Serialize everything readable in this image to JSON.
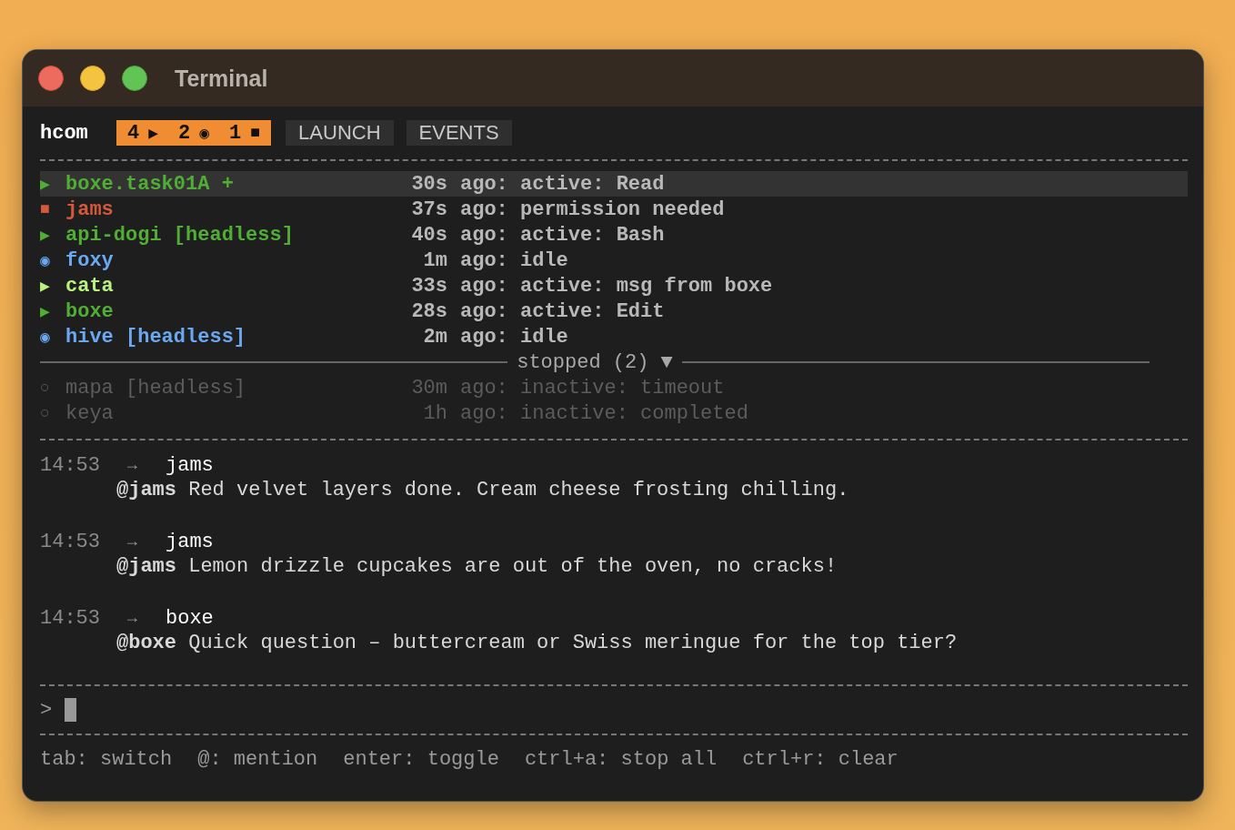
{
  "window": {
    "title": "Terminal"
  },
  "header": {
    "app": "hcom",
    "counts": [
      {
        "count": "4",
        "symbol": "▶"
      },
      {
        "count": "2",
        "symbol": "◉"
      },
      {
        "count": "1",
        "symbol": "■"
      }
    ],
    "tabs": [
      {
        "label": "LAUNCH",
        "selected": false
      },
      {
        "label": "EVENTS",
        "selected": false
      }
    ]
  },
  "agents": [
    {
      "symbol": "▶",
      "name": "boxe.task01A +",
      "time": "30s",
      "status": "ago: active: Read",
      "color": "#4fae33",
      "selected": true
    },
    {
      "symbol": "■",
      "name": "jams",
      "time": "37s",
      "status": "ago: permission needed",
      "color": "#d4583b",
      "selected": false
    },
    {
      "symbol": "▶",
      "name": "api-dogi [headless]",
      "time": "40s",
      "status": "ago: active: Bash",
      "color": "#4fae33",
      "selected": false
    },
    {
      "symbol": "◉",
      "name": "foxy",
      "time": "1m",
      "status": "ago: idle",
      "color": "#6aa9f2",
      "selected": false
    },
    {
      "symbol": "▶",
      "name": "cata",
      "time": "33s",
      "status": "ago: active: msg from boxe",
      "color": "#b8f27c",
      "selected": false
    },
    {
      "symbol": "▶",
      "name": "boxe",
      "time": "28s",
      "status": "ago: active: Edit",
      "color": "#4fae33",
      "selected": false
    },
    {
      "symbol": "◉",
      "name": "hive [headless]",
      "time": "2m",
      "status": "ago: idle",
      "color": "#6aa9f2",
      "selected": false
    }
  ],
  "stopped_group": {
    "label": "stopped (2)",
    "toggle": "▼",
    "expanded": true,
    "agents": [
      {
        "symbol": "○",
        "name": "mapa [headless]",
        "time": "30m",
        "status": "ago: inactive: timeout"
      },
      {
        "symbol": "○",
        "name": "keya",
        "time": "1h",
        "status": "ago: inactive: completed"
      }
    ]
  },
  "messages": [
    {
      "time": "14:53",
      "arrow": "→",
      "to": "jams",
      "text": "**@jams** Red velvet layers done. Cream cheese frosting chilling."
    },
    {
      "time": "14:53",
      "arrow": "→",
      "to": "jams",
      "text": "**@jams** Lemon drizzle cupcakes are out of the oven, no cracks!"
    },
    {
      "time": "14:53",
      "arrow": "→",
      "to": "boxe",
      "text": "**@boxe** Quick question – buttercream or Swiss meringue for the top tier?"
    }
  ],
  "input": {
    "prompt": ">"
  },
  "hints": [
    "tab: switch",
    "@: mention",
    "enter: toggle",
    "ctrl+a: stop all",
    "ctrl+r: clear"
  ]
}
